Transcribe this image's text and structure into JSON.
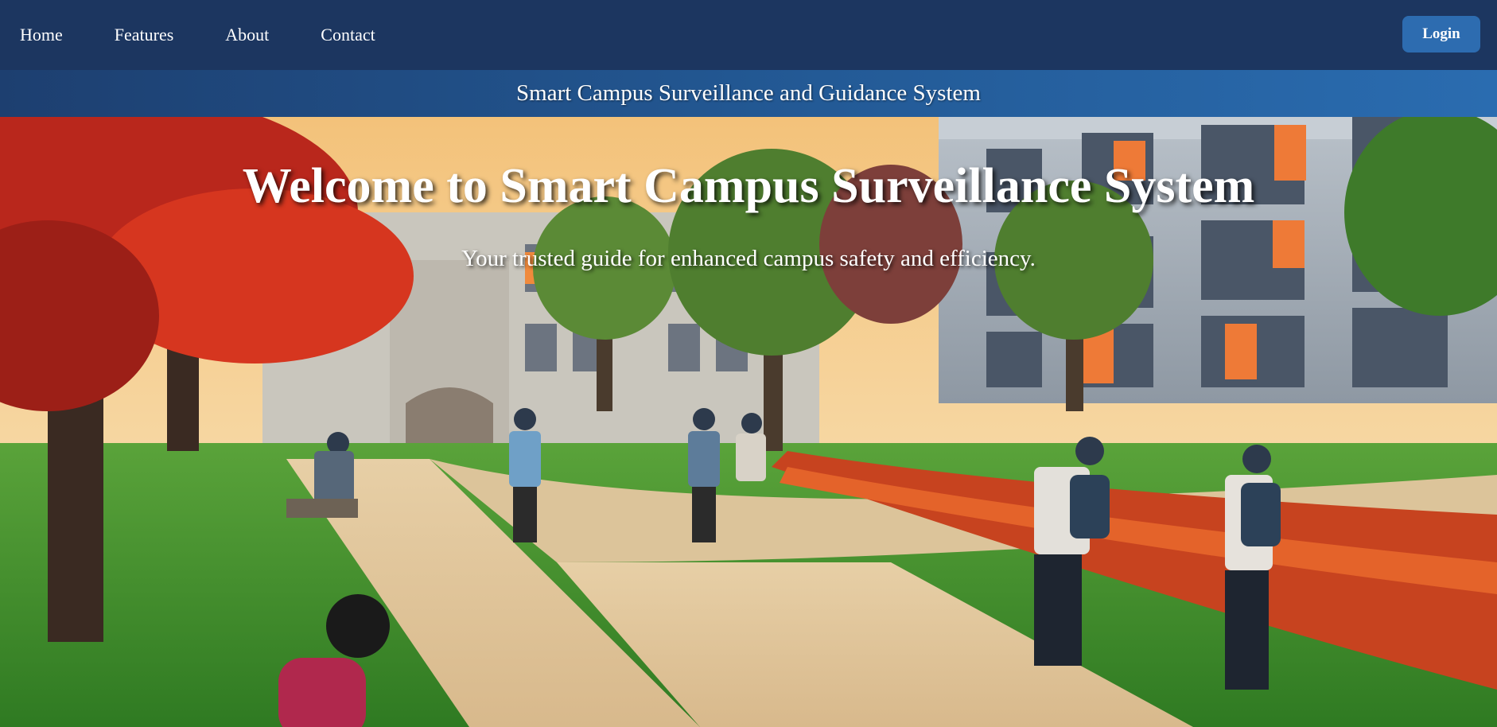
{
  "nav": {
    "links": [
      "Home",
      "Features",
      "About",
      "Contact"
    ],
    "login_label": "Login"
  },
  "subheader": {
    "title": "Smart Campus Surveillance and Guidance System"
  },
  "hero": {
    "heading": "Welcome to Smart Campus Surveillance System",
    "tagline": "Your trusted guide for enhanced campus safety and efficiency.",
    "image_alt": "campus-photo"
  },
  "colors": {
    "nav_bg": "#1c3660",
    "subheader_start": "#1d3f70",
    "subheader_end": "#2a6cb0",
    "login_bg": "#2d6cb0"
  }
}
